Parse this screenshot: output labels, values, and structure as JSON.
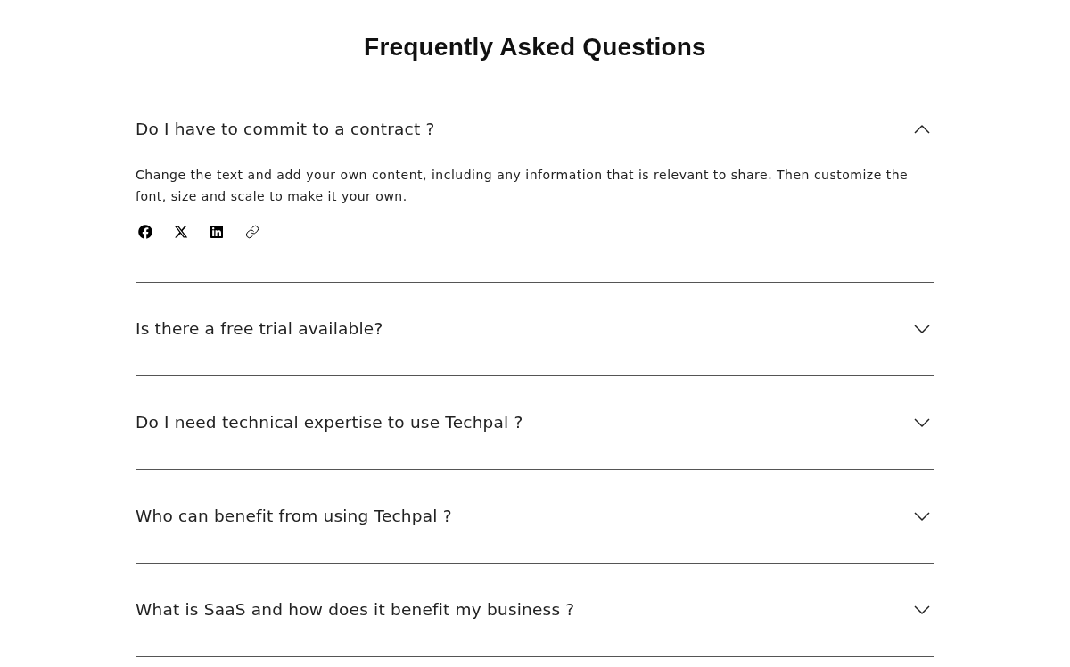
{
  "title": "Frequently Asked Questions",
  "faqs": [
    {
      "question": "Do I have to commit to a contract ?",
      "expanded": true,
      "answer": "Change the text and add your own content, including any information that is relevant to share. Then customize the font, size and scale to make it your own."
    },
    {
      "question": "Is there a free trial available?",
      "expanded": false
    },
    {
      "question": "Do I need technical expertise to use Techpal ?",
      "expanded": false
    },
    {
      "question": "Who can benefit from using Techpal ?",
      "expanded": false
    },
    {
      "question": "What is SaaS and how does it benefit my business ?",
      "expanded": false
    }
  ]
}
